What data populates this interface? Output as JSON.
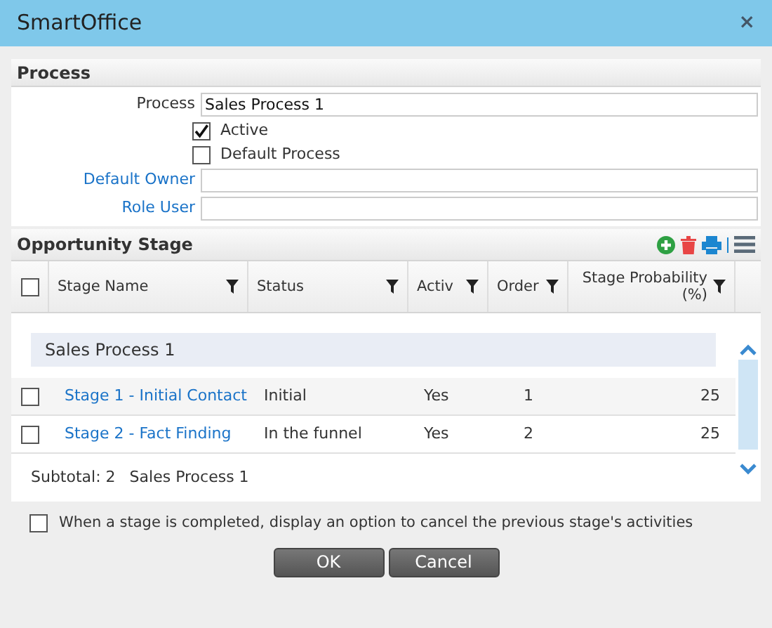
{
  "window": {
    "title": "SmartOffice",
    "close": "×"
  },
  "process": {
    "title": "Process",
    "fields": [
      {
        "kind": "text",
        "label": "Process",
        "value": "Sales Process 1",
        "link": false
      },
      {
        "kind": "checkbox",
        "label": "Active",
        "checked": true
      },
      {
        "kind": "checkbox",
        "label": "Default Process",
        "checked": false
      },
      {
        "kind": "text",
        "label": "Default Owner",
        "link": true
      },
      {
        "kind": "text",
        "label": "Role User",
        "link": true
      }
    ]
  },
  "stages": {
    "title": "Opportunity Stage",
    "columns": [
      {
        "label": "Stage Name"
      },
      {
        "label": "Status"
      },
      {
        "label": "Activ"
      },
      {
        "label": "Order"
      },
      {
        "label": "Stage Probability (%)"
      }
    ],
    "all_checked": false,
    "group": "Sales Process 1",
    "rows": [
      {
        "checked": false,
        "cells": [
          "Stage 1 - Initial Contact",
          "Initial",
          "Yes",
          "1",
          "25"
        ]
      },
      {
        "checked": false,
        "cells": [
          "Stage 2 - Fact Finding",
          "In the funnel",
          "Yes",
          "2",
          "25"
        ]
      }
    ],
    "subtotal": "Subtotal: 2",
    "subtotal_group": "Sales Process 1"
  },
  "cancel_option": {
    "label": "When a stage is completed, display an option to cancel the previous stage's activities",
    "checked": false
  },
  "buttons": [
    "OK",
    "Cancel"
  ]
}
